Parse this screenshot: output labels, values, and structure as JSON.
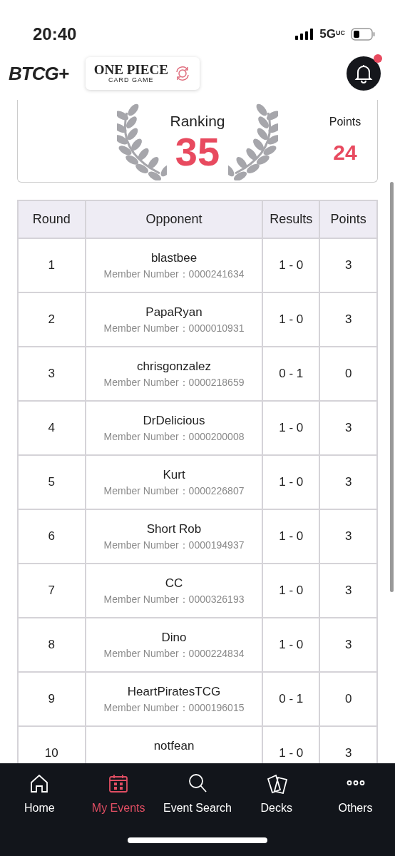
{
  "status_bar": {
    "time": "20:40",
    "network": "5G",
    "network_suffix": "UC"
  },
  "header": {
    "app_logo": "BTCG+",
    "game_logo_title": "ONE PIECE",
    "game_logo_subtitle": "CARD GAME",
    "notification_unread": true
  },
  "summary": {
    "ranking_label": "Ranking",
    "ranking": "35",
    "points_label": "Points",
    "points": "24"
  },
  "table": {
    "columns": [
      "Round",
      "Opponent",
      "Results",
      "Points"
    ],
    "rows": [
      {
        "round": "1",
        "opponent": "blastbee",
        "member_number": "Member Number：0000241634",
        "result": "1 - 0",
        "points": "3"
      },
      {
        "round": "2",
        "opponent": "PapaRyan",
        "member_number": "Member Number：0000010931",
        "result": "1 - 0",
        "points": "3"
      },
      {
        "round": "3",
        "opponent": "chrisgonzalez",
        "member_number": "Member Number：0000218659",
        "result": "0 - 1",
        "points": "0"
      },
      {
        "round": "4",
        "opponent": "DrDelicious",
        "member_number": "Member Number：0000200008",
        "result": "1 - 0",
        "points": "3"
      },
      {
        "round": "5",
        "opponent": "Kurt",
        "member_number": "Member Number：0000226807",
        "result": "1 - 0",
        "points": "3"
      },
      {
        "round": "6",
        "opponent": "Short Rob",
        "member_number": "Member Number：0000194937",
        "result": "1 - 0",
        "points": "3"
      },
      {
        "round": "7",
        "opponent": "CC",
        "member_number": "Member Number：0000326193",
        "result": "1 - 0",
        "points": "3"
      },
      {
        "round": "8",
        "opponent": "Dino",
        "member_number": "Member Number：0000224834",
        "result": "1 - 0",
        "points": "3"
      },
      {
        "round": "9",
        "opponent": "HeartPiratesTCG",
        "member_number": "Member Number：0000196015",
        "result": "0 - 1",
        "points": "0"
      },
      {
        "round": "10",
        "opponent": "notfean",
        "result": "1 - 0",
        "points": "3"
      }
    ]
  },
  "tab_bar": [
    {
      "kind": "home",
      "label": "Home",
      "selected": false
    },
    {
      "kind": "events",
      "label": "My Events",
      "selected": true
    },
    {
      "kind": "search",
      "label": "Event Search",
      "selected": false
    },
    {
      "kind": "decks",
      "label": "Decks",
      "selected": false
    },
    {
      "kind": "others",
      "label": "Others",
      "selected": false
    }
  ]
}
